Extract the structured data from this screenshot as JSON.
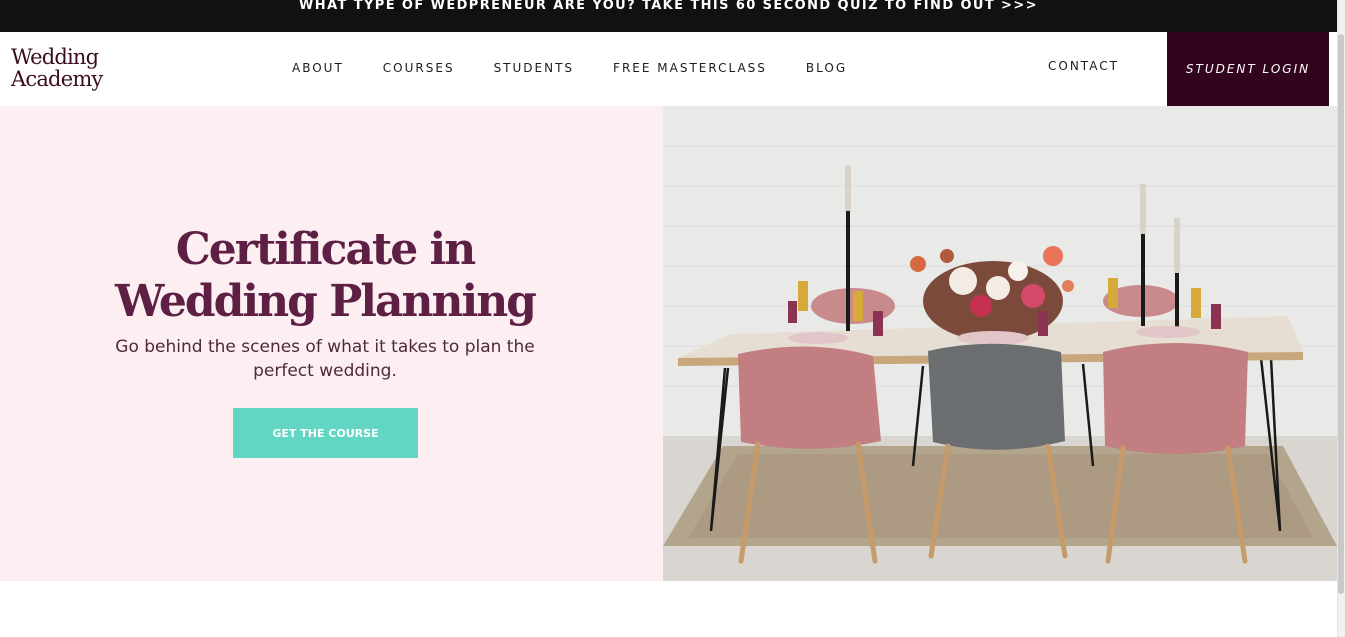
{
  "promo_bar": {
    "text": "WHAT TYPE OF WEDPRENEUR ARE YOU? TAKE THIS 60 SECOND QUIZ TO FIND OUT >>>"
  },
  "logo": {
    "line1": "Wedding",
    "line2": "Academy"
  },
  "nav": {
    "items": [
      {
        "label": "ABOUT"
      },
      {
        "label": "COURSES"
      },
      {
        "label": "STUDENTS"
      },
      {
        "label": "FREE MASTERCLASS"
      },
      {
        "label": "BLOG"
      }
    ],
    "contact_label": "CONTACT",
    "login_label": "STUDENT LOGIN"
  },
  "hero": {
    "title_line1": "Certificate in",
    "title_line2": "Wedding Planning",
    "subtitle": "Go behind the scenes of what it takes to plan the perfect wedding.",
    "cta_label": "GET THE COURSE",
    "image_icon": "dining-table-photo"
  },
  "colors": {
    "promo_bg": "#111111",
    "brand_dark": "#33041d",
    "hero_bg": "#fdeef1",
    "title": "#5e1f45",
    "cta": "#62d6c3"
  }
}
